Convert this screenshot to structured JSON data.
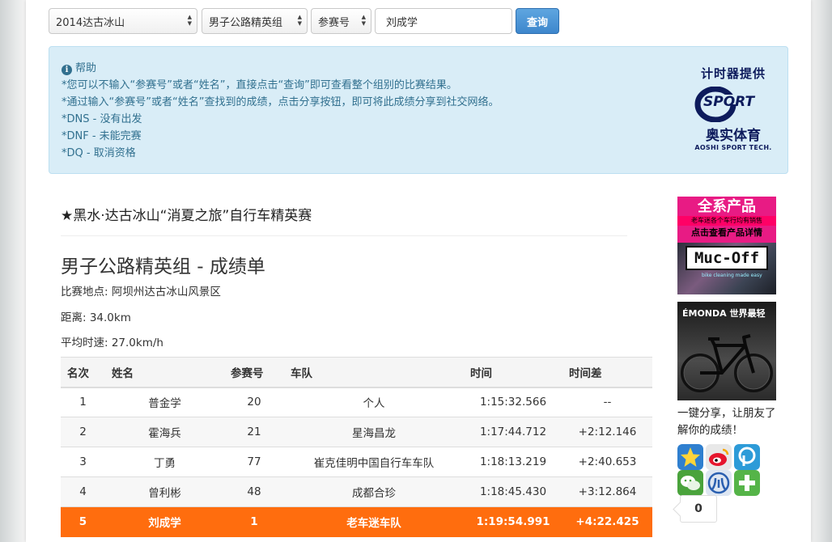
{
  "search": {
    "event_select": "2014达古冰山",
    "group_select": "男子公路精英组",
    "field_select": "参赛号",
    "name_input": "刘成学",
    "query_button": "查询"
  },
  "help": {
    "title": "帮助",
    "lines": [
      "*您可以不输入“参赛号”或者“姓名”，直接点击“查询”即可查看整个组别的比赛结果。",
      "*通过输入“参赛号”或者“姓名”查找到的成绩，点击分享按钮，即可将此成绩分享到社交网络。",
      "*DNS - 没有出发",
      "*DNF - 未能完赛",
      "*DQ - 取消资格"
    ],
    "sponsor_title": "计时器提供",
    "sponsor_logo": "SPORT",
    "sponsor_name": "奥实体育",
    "sponsor_en": "AOSHI SPORT TECH."
  },
  "event": {
    "title": "★黑水·达古冰山“消夏之旅”自行车精英赛",
    "group_title": "男子公路精英组 - 成绩单",
    "location": "比赛地点: 阿坝州达古冰山风景区",
    "distance": "距离: 34.0km",
    "avg_speed": "平均时速: 27.0km/h"
  },
  "table": {
    "headers": [
      "名次",
      "姓名",
      "参赛号",
      "车队",
      "时间",
      "时间差"
    ],
    "rows": [
      [
        "1",
        "普金学",
        "20",
        "个人",
        "1:15:32.566",
        "--"
      ],
      [
        "2",
        "霍海兵",
        "21",
        "星海昌龙",
        "1:17:44.712",
        "+2:12.146"
      ],
      [
        "3",
        "丁勇",
        "77",
        "崔克佳明中国自行车车队",
        "1:18:13.219",
        "+2:40.653"
      ],
      [
        "4",
        "曾利彬",
        "48",
        "成都合珍",
        "1:18:45.430",
        "+3:12.864"
      ],
      [
        "5",
        "刘成学",
        "1",
        "老车迷车队",
        "1:19:54.991",
        "+4:22.425"
      ]
    ]
  },
  "sidebar": {
    "ad1_title": "全系产品",
    "ad1_sub": "老车迷各个车行均有销售",
    "ad1_cta": "点击查看产品详情",
    "ad1_brand": "Muc-Off",
    "ad1_tag": "bike cleaning made easy",
    "ad2_title": "ÉMONDA 世界最轻",
    "share_text": "一键分享，让朋友了解你的成绩！",
    "share_count": "0"
  },
  "colors": {
    "highlight_row": "#ff6d0e",
    "help_bg": "#d9edf7",
    "help_text": "#31708f",
    "button": "#3d86cc"
  }
}
